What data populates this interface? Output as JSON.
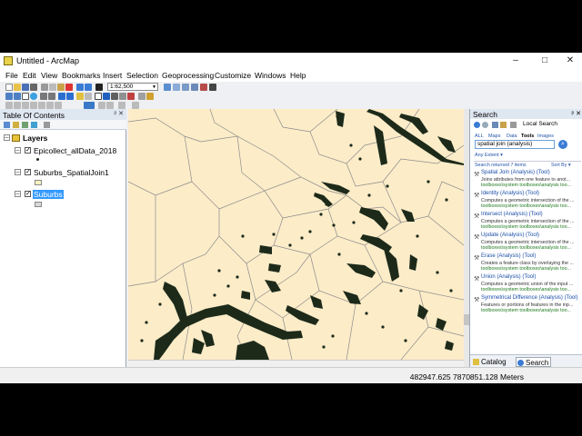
{
  "window": {
    "title": "Untitled - ArcMap",
    "minimize": "–",
    "maximize": "□",
    "close": "✕"
  },
  "menu": [
    "File",
    "Edit",
    "View",
    "Bookmarks",
    "Insert",
    "Selection",
    "Geoprocessing",
    "Customize",
    "Windows",
    "Help"
  ],
  "toolbar": {
    "scale": "1:62,500"
  },
  "toc": {
    "title": "Table Of Contents",
    "pin": "ᵖ ✕",
    "group": "Layers",
    "layers": [
      {
        "name": "Epicollect_allData_2018",
        "checked": true,
        "selected": false
      },
      {
        "name": "Suburbs_SpatialJoin1",
        "checked": true,
        "selected": false
      },
      {
        "name": "Suburbs",
        "checked": true,
        "selected": true
      }
    ]
  },
  "search": {
    "title": "Search",
    "pin": "ᵖ ✕",
    "tabs": [
      "ALL",
      "Maps",
      "Data",
      "Tools",
      "Images"
    ],
    "selected_tab": "Tools",
    "local_search": "Local Search",
    "query": "spatial join (analysis)",
    "any_extent": "Any Extent ▾",
    "returned": "Search returned 7 items",
    "sort_by": "Sort By ▾",
    "results": [
      {
        "title": "Spatial Join (Analysis) (Tool)",
        "desc": "Joins attributes from one feature to anot...",
        "path": "toolboxes\\system toolboxes\\analysis too..."
      },
      {
        "title": "Identity (Analysis) (Tool)",
        "desc": "Computes a geometric intersection of the ...",
        "path": "toolboxes\\system toolboxes\\analysis too..."
      },
      {
        "title": "Intersect (Analysis) (Tool)",
        "desc": "Computes a geometric intersection of the ...",
        "path": "toolboxes\\system toolboxes\\analysis too..."
      },
      {
        "title": "Update (Analysis) (Tool)",
        "desc": "Computes a geometric intersection of the ...",
        "path": "toolboxes\\system toolboxes\\analysis too..."
      },
      {
        "title": "Erase (Analysis) (Tool)",
        "desc": "Creates a feature class by overlaying the ...",
        "path": "toolboxes\\system toolboxes\\analysis too..."
      },
      {
        "title": "Union (Analysis) (Tool)",
        "desc": "Computes a geometric union of the input ...",
        "path": "toolboxes\\system toolboxes\\analysis too..."
      },
      {
        "title": "Symmetrical Difference (Analysis) (Tool)",
        "desc": "Features or portions of features in the inp...",
        "path": "toolboxes\\system toolboxes\\analysis too..."
      }
    ],
    "footer_tabs": [
      "Catalog",
      "Search"
    ],
    "footer_selected": "Search"
  },
  "status": {
    "coordinates": "482947.625  7870851.128 Meters"
  },
  "colors": {
    "map_fill": "#fcecc8",
    "map_line": "#8c8c8c",
    "points": "#1d2a1a",
    "selection": "#3399ff",
    "panel_header": "#dfe7f1"
  }
}
